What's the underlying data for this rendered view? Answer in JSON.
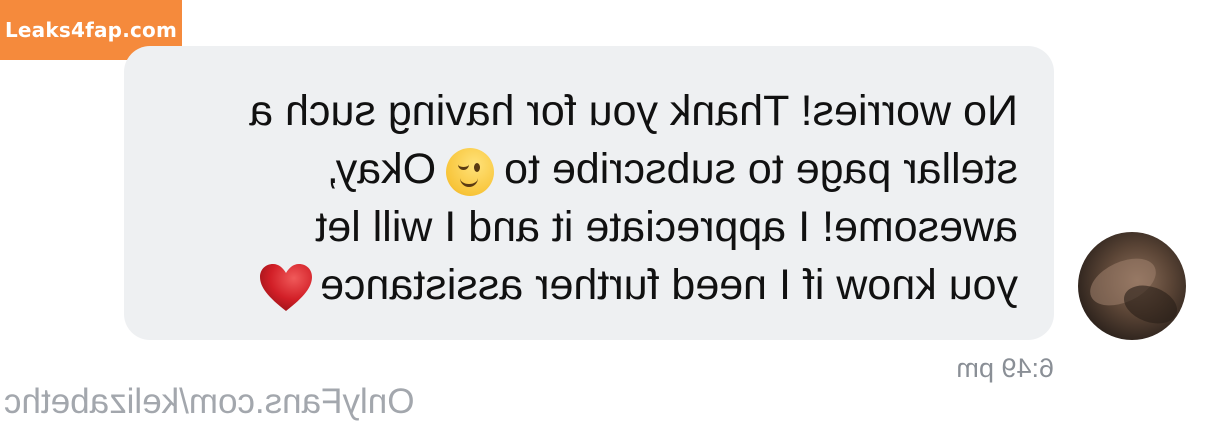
{
  "watermark": {
    "label": "Leaks4fap.com",
    "color": "#f58a3c"
  },
  "message": {
    "lines": [
      "No worries! Thank you for having such a",
      "stellar page to subscribe to",
      "awesome! I appreciate it and I will let",
      "you know if I need further assistance"
    ],
    "line2_suffix": "Okay,",
    "emojis": [
      "wink-face-emoji",
      "red-heart-emoji"
    ],
    "timestamp": "6:49 pm",
    "mirrored": true
  },
  "footer": {
    "url": "OnlyFans.com/kelizabethc"
  },
  "colors": {
    "bubble": "#eef0f2",
    "text": "#111111",
    "timestamp": "#8a8f96"
  }
}
